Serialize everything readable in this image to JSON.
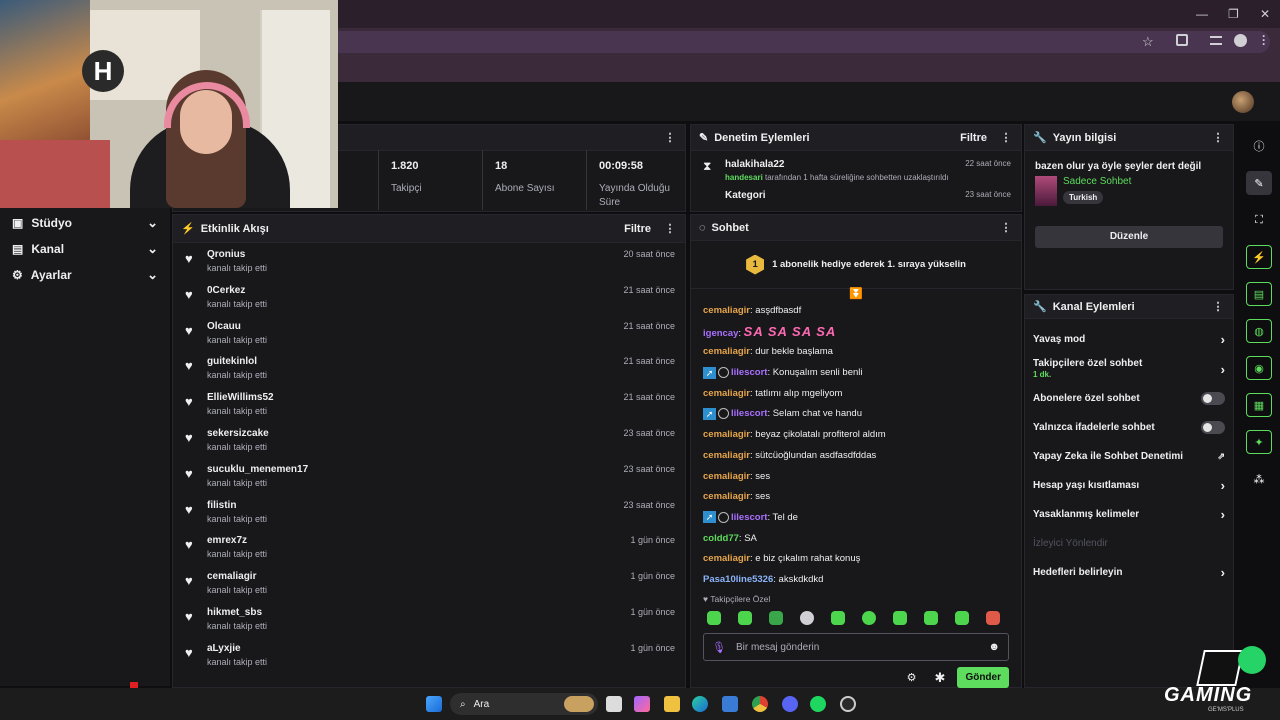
{
  "browser": {
    "window_controls": [
      "—",
      "❐",
      "✕"
    ],
    "toolbar_icons": [
      "star-icon",
      "extensions-icon",
      "media-icon",
      "profile-icon",
      "menu-icon"
    ]
  },
  "webcam": {
    "logo_text": "H"
  },
  "nav": {
    "items": [
      {
        "label": "Stüdyo",
        "icon": "studio-icon"
      },
      {
        "label": "Kanal",
        "icon": "channel-icon"
      },
      {
        "label": "Ayarlar",
        "icon": "gear-icon"
      }
    ]
  },
  "stats": [
    {
      "value": "1.820",
      "label": "Takipçi"
    },
    {
      "value": "18",
      "label": "Abone Sayısı"
    },
    {
      "value": "00:09:58",
      "label": "Yayında Olduğu Süre"
    }
  ],
  "moderation": {
    "title": "Denetim Eylemleri",
    "filter": "Filtre",
    "items": [
      {
        "name": "halakihala22",
        "time": "22 saat önce",
        "actor": "handesari",
        "detail": "tarafından 1 hafta süreliğine sohbetten uzaklaştırıldı"
      },
      {
        "name": "Kategori",
        "time": "23 saat önce"
      }
    ]
  },
  "stream_info": {
    "title": "Yayın bilgisi",
    "stream_title": "bazen olur ya öyle şeyler dert değil",
    "category": "Sadece Sohbet",
    "tag": "Turkish",
    "edit_button": "Düzenle"
  },
  "activity": {
    "title": "Etkinlik Akışı",
    "filter": "Filtre",
    "items": [
      {
        "name": "Qronius",
        "sub": "kanalı takip etti",
        "time": "20 saat önce"
      },
      {
        "name": "0Cerkez",
        "sub": "kanalı takip etti",
        "time": "21 saat önce"
      },
      {
        "name": "Olcauu",
        "sub": "kanalı takip etti",
        "time": "21 saat önce"
      },
      {
        "name": "guitekinlol",
        "sub": "kanalı takip etti",
        "time": "21 saat önce"
      },
      {
        "name": "EllieWillims52",
        "sub": "kanalı takip etti",
        "time": "21 saat önce"
      },
      {
        "name": "sekersizcake",
        "sub": "kanalı takip etti",
        "time": "23 saat önce"
      },
      {
        "name": "sucuklu_menemen17",
        "sub": "kanalı takip etti",
        "time": "23 saat önce"
      },
      {
        "name": "filistin",
        "sub": "kanalı takip etti",
        "time": "23 saat önce"
      },
      {
        "name": "emrex7z",
        "sub": "kanalı takip etti",
        "time": "1 gün önce"
      },
      {
        "name": "cemaliagir",
        "sub": "kanalı takip etti",
        "time": "1 gün önce"
      },
      {
        "name": "hikmet_sbs",
        "sub": "kanalı takip etti",
        "time": "1 gün önce"
      },
      {
        "name": "aLyxjie",
        "sub": "kanalı takip etti",
        "time": "1 gün önce"
      }
    ]
  },
  "chat": {
    "title": "Sohbet",
    "goal_rank": "1",
    "goal_text": "1 abonelik hediye ederek 1. sıraya yükselin",
    "messages": [
      {
        "user": "cemaliagir",
        "color": "orange",
        "text": "asşdfbasdf"
      },
      {
        "user": "igencay",
        "color": "purple",
        "text": "SA SA SA SA",
        "emote": true
      },
      {
        "user": "cemaliagir",
        "color": "orange",
        "text": "dur bekle başlama"
      },
      {
        "user": "lilescort",
        "color": "purple",
        "text": "Konuşalım senli benli",
        "badges": true
      },
      {
        "user": "cemaliagir",
        "color": "orange",
        "text": "tatlımı alıp mgeliyom"
      },
      {
        "user": "lilescort",
        "color": "purple",
        "text": "Selam chat ve handu",
        "badges": true
      },
      {
        "user": "cemaliagir",
        "color": "orange",
        "text": "beyaz çikolatalı profiterol aldım"
      },
      {
        "user": "cemaliagir",
        "color": "orange",
        "text": "sütcüoğlundan asdfasdfddas"
      },
      {
        "user": "cemaliagir",
        "color": "orange",
        "text": "ses"
      },
      {
        "user": "cemaliagir",
        "color": "orange",
        "text": "ses"
      },
      {
        "user": "lilescort",
        "color": "purple",
        "text": "Tel de",
        "badges": true
      },
      {
        "user": "coldd77",
        "color": "green",
        "text": "SA"
      },
      {
        "user": "cemaliagir",
        "color": "orange",
        "text": "e biz çıkalım rahat konuş"
      },
      {
        "user": "Pasa10line5326",
        "color": "blue",
        "text": "akskdkdkd"
      }
    ],
    "followers_only": "Takipçilere Özel",
    "input_placeholder": "Bir mesaj gönderin",
    "send_button": "Gönder"
  },
  "channel_actions": {
    "title": "Kanal Eylemleri",
    "items": [
      {
        "label": "Yavaş mod",
        "type": "chevron"
      },
      {
        "label": "Takipçilere özel sohbet",
        "sub": "1 dk.",
        "type": "chevron"
      },
      {
        "label": "Abonelere özel sohbet",
        "type": "toggle"
      },
      {
        "label": "Yalnızca ifadelerle sohbet",
        "type": "toggle"
      },
      {
        "label": "Yapay Zeka ile Sohbet Denetimi",
        "type": "external"
      },
      {
        "label": "Hesap yaşı kısıtlaması",
        "type": "chevron"
      },
      {
        "label": "Yasaklanmış kelimeler",
        "type": "chevron"
      },
      {
        "label": "İzleyici Yönlendir",
        "type": "disabled"
      },
      {
        "label": "Hedefleri belirleyin",
        "type": "chevron"
      }
    ]
  },
  "overlay": {
    "instagram_handle": "handesari",
    "brand_text": "GAMING",
    "brand_sub": "GE'MS'PLUS"
  },
  "taskbar": {
    "search_label": "Ara"
  },
  "colors": {
    "accent_green": "#5ddc5d",
    "panel_bg": "#18181b",
    "purple": "#a970ff"
  }
}
